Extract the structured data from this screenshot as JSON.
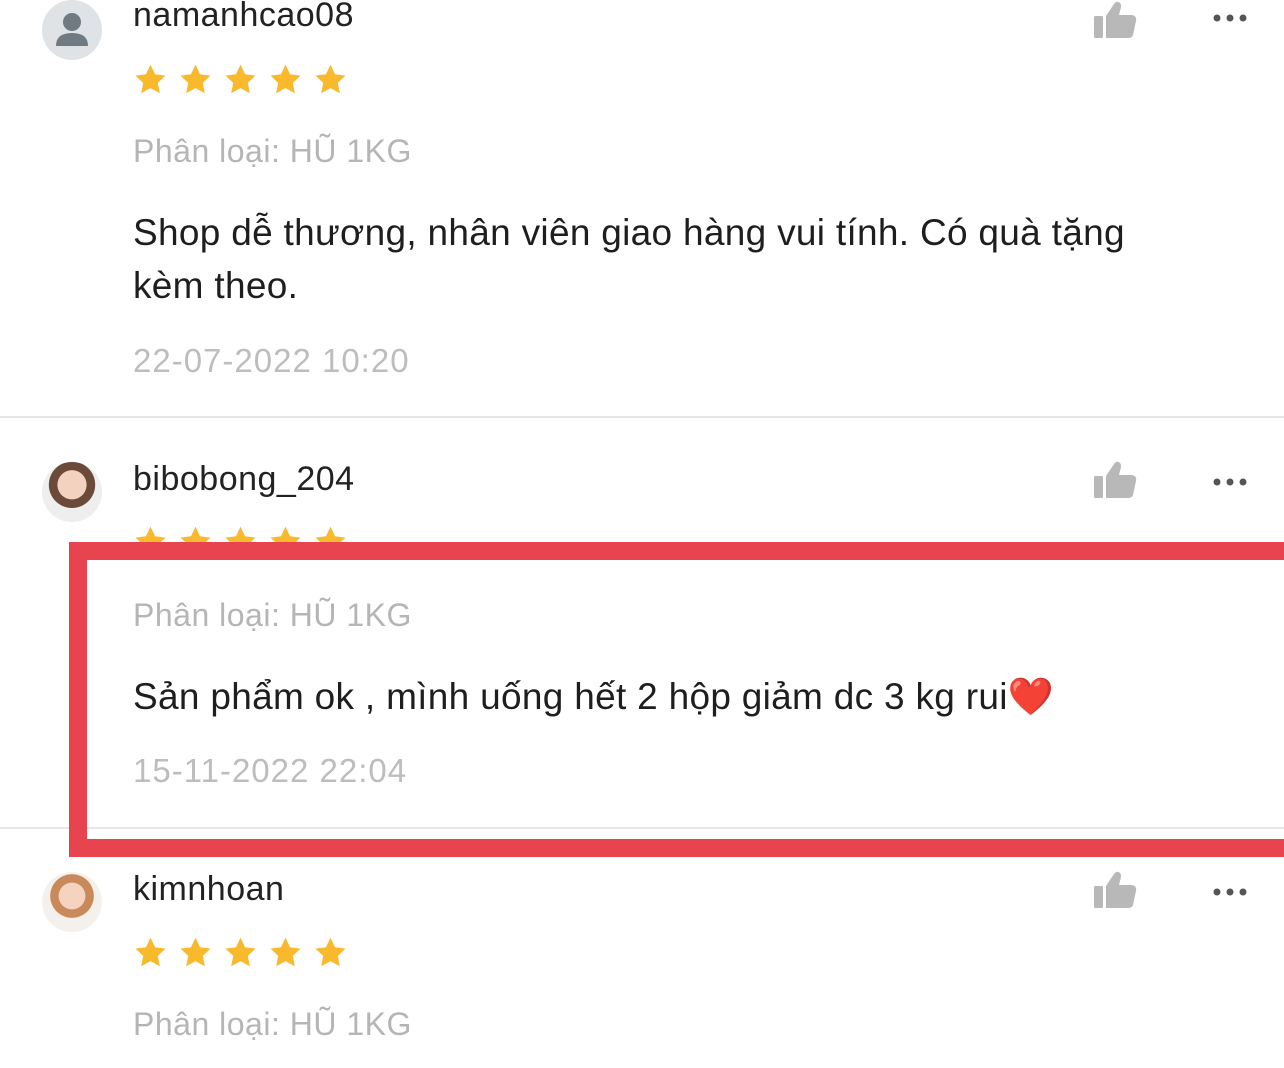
{
  "colors": {
    "star": "#f9b92c",
    "highlight_border": "#e8444f",
    "muted_text": "#b5b5b5",
    "icon_gray": "#b8b8b8"
  },
  "reviews": [
    {
      "username": "namanhcao08",
      "rating": 5,
      "variant": "Phân loại: HŨ 1KG",
      "comment": "Shop dễ thương, nhân viên giao hàng vui tính. Có quà tặng kèm theo.",
      "date": "22-07-2022 10:20"
    },
    {
      "username": "bibobong_204",
      "rating": 5,
      "variant": "Phân loại: HŨ 1KG",
      "comment": "Sản phẩm ok , mình uống hết 2 hộp giảm dc 3 kg rui❤️",
      "date": "15-11-2022 22:04"
    },
    {
      "username": "kimnhoan",
      "rating": 5,
      "variant": "Phân loại: HŨ 1KG"
    }
  ]
}
